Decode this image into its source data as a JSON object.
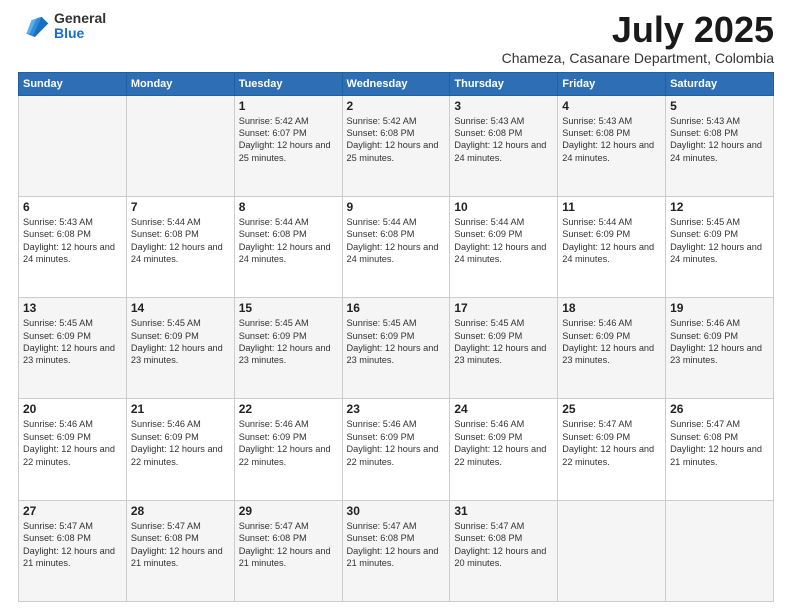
{
  "logo": {
    "general": "General",
    "blue": "Blue"
  },
  "header": {
    "title": "July 2025",
    "subtitle": "Chameza, Casanare Department, Colombia"
  },
  "days_of_week": [
    "Sunday",
    "Monday",
    "Tuesday",
    "Wednesday",
    "Thursday",
    "Friday",
    "Saturday"
  ],
  "weeks": [
    [
      {
        "day": "",
        "info": ""
      },
      {
        "day": "",
        "info": ""
      },
      {
        "day": "1",
        "info": "Sunrise: 5:42 AM\nSunset: 6:07 PM\nDaylight: 12 hours and 25 minutes."
      },
      {
        "day": "2",
        "info": "Sunrise: 5:42 AM\nSunset: 6:08 PM\nDaylight: 12 hours and 25 minutes."
      },
      {
        "day": "3",
        "info": "Sunrise: 5:43 AM\nSunset: 6:08 PM\nDaylight: 12 hours and 24 minutes."
      },
      {
        "day": "4",
        "info": "Sunrise: 5:43 AM\nSunset: 6:08 PM\nDaylight: 12 hours and 24 minutes."
      },
      {
        "day": "5",
        "info": "Sunrise: 5:43 AM\nSunset: 6:08 PM\nDaylight: 12 hours and 24 minutes."
      }
    ],
    [
      {
        "day": "6",
        "info": "Sunrise: 5:43 AM\nSunset: 6:08 PM\nDaylight: 12 hours and 24 minutes."
      },
      {
        "day": "7",
        "info": "Sunrise: 5:44 AM\nSunset: 6:08 PM\nDaylight: 12 hours and 24 minutes."
      },
      {
        "day": "8",
        "info": "Sunrise: 5:44 AM\nSunset: 6:08 PM\nDaylight: 12 hours and 24 minutes."
      },
      {
        "day": "9",
        "info": "Sunrise: 5:44 AM\nSunset: 6:08 PM\nDaylight: 12 hours and 24 minutes."
      },
      {
        "day": "10",
        "info": "Sunrise: 5:44 AM\nSunset: 6:09 PM\nDaylight: 12 hours and 24 minutes."
      },
      {
        "day": "11",
        "info": "Sunrise: 5:44 AM\nSunset: 6:09 PM\nDaylight: 12 hours and 24 minutes."
      },
      {
        "day": "12",
        "info": "Sunrise: 5:45 AM\nSunset: 6:09 PM\nDaylight: 12 hours and 24 minutes."
      }
    ],
    [
      {
        "day": "13",
        "info": "Sunrise: 5:45 AM\nSunset: 6:09 PM\nDaylight: 12 hours and 23 minutes."
      },
      {
        "day": "14",
        "info": "Sunrise: 5:45 AM\nSunset: 6:09 PM\nDaylight: 12 hours and 23 minutes."
      },
      {
        "day": "15",
        "info": "Sunrise: 5:45 AM\nSunset: 6:09 PM\nDaylight: 12 hours and 23 minutes."
      },
      {
        "day": "16",
        "info": "Sunrise: 5:45 AM\nSunset: 6:09 PM\nDaylight: 12 hours and 23 minutes."
      },
      {
        "day": "17",
        "info": "Sunrise: 5:45 AM\nSunset: 6:09 PM\nDaylight: 12 hours and 23 minutes."
      },
      {
        "day": "18",
        "info": "Sunrise: 5:46 AM\nSunset: 6:09 PM\nDaylight: 12 hours and 23 minutes."
      },
      {
        "day": "19",
        "info": "Sunrise: 5:46 AM\nSunset: 6:09 PM\nDaylight: 12 hours and 23 minutes."
      }
    ],
    [
      {
        "day": "20",
        "info": "Sunrise: 5:46 AM\nSunset: 6:09 PM\nDaylight: 12 hours and 22 minutes."
      },
      {
        "day": "21",
        "info": "Sunrise: 5:46 AM\nSunset: 6:09 PM\nDaylight: 12 hours and 22 minutes."
      },
      {
        "day": "22",
        "info": "Sunrise: 5:46 AM\nSunset: 6:09 PM\nDaylight: 12 hours and 22 minutes."
      },
      {
        "day": "23",
        "info": "Sunrise: 5:46 AM\nSunset: 6:09 PM\nDaylight: 12 hours and 22 minutes."
      },
      {
        "day": "24",
        "info": "Sunrise: 5:46 AM\nSunset: 6:09 PM\nDaylight: 12 hours and 22 minutes."
      },
      {
        "day": "25",
        "info": "Sunrise: 5:47 AM\nSunset: 6:09 PM\nDaylight: 12 hours and 22 minutes."
      },
      {
        "day": "26",
        "info": "Sunrise: 5:47 AM\nSunset: 6:08 PM\nDaylight: 12 hours and 21 minutes."
      }
    ],
    [
      {
        "day": "27",
        "info": "Sunrise: 5:47 AM\nSunset: 6:08 PM\nDaylight: 12 hours and 21 minutes."
      },
      {
        "day": "28",
        "info": "Sunrise: 5:47 AM\nSunset: 6:08 PM\nDaylight: 12 hours and 21 minutes."
      },
      {
        "day": "29",
        "info": "Sunrise: 5:47 AM\nSunset: 6:08 PM\nDaylight: 12 hours and 21 minutes."
      },
      {
        "day": "30",
        "info": "Sunrise: 5:47 AM\nSunset: 6:08 PM\nDaylight: 12 hours and 21 minutes."
      },
      {
        "day": "31",
        "info": "Sunrise: 5:47 AM\nSunset: 6:08 PM\nDaylight: 12 hours and 20 minutes."
      },
      {
        "day": "",
        "info": ""
      },
      {
        "day": "",
        "info": ""
      }
    ]
  ]
}
